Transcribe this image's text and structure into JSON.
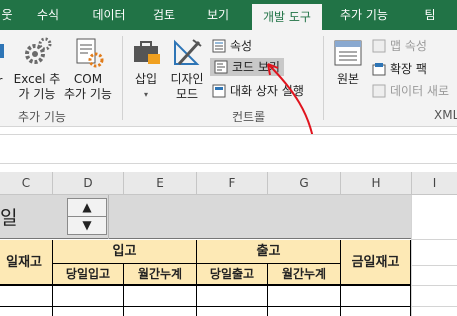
{
  "tabs": [
    "웃",
    "수식",
    "데이터",
    "검토",
    "보기",
    "개발 도구",
    "추가 기능",
    "팀"
  ],
  "ribbon": {
    "addins_group": {
      "excel_addin_label": "Excel 추\n가 기능",
      "com_addin_label": "COM\n추가 기능",
      "group_label": "추가 기능"
    },
    "controls_group": {
      "insert_label": "삽입",
      "design_mode_label": "디자인\n모드",
      "properties_label": "속성",
      "view_code_label": "코드 보기",
      "run_dialog_label": "대화 상자 실행",
      "group_label": "컨트롤"
    },
    "xml_group": {
      "source_label": "원본",
      "map_properties_label": "맵 속성",
      "expansion_packs_label": "확장 팩",
      "refresh_data_label": "데이터 새로",
      "group_label": "XML"
    }
  },
  "columns": [
    "C",
    "D",
    "E",
    "F",
    "G",
    "H",
    "I"
  ],
  "sheet": {
    "title_fragment": "일",
    "header_left": "일재고",
    "header_in": "입고",
    "header_out": "출고",
    "header_right": "금일재고",
    "sub_in_daily": "당일입고",
    "sub_in_month": "월간누계",
    "sub_out_daily": "당일출고",
    "sub_out_month": "월간누계"
  },
  "colors": {
    "ribbon_green": "#217346",
    "header_fill": "#fde9b5",
    "annotation_red": "#e0141e"
  },
  "icons": [
    "excel-addin-icon",
    "com-addin-icon",
    "insert-icon",
    "design-mode-icon",
    "properties-icon",
    "view-code-icon",
    "run-dialog-icon",
    "source-icon",
    "map-properties-icon",
    "expansion-packs-icon",
    "refresh-data-icon",
    "spinner-up-icon",
    "spinner-down-icon"
  ]
}
